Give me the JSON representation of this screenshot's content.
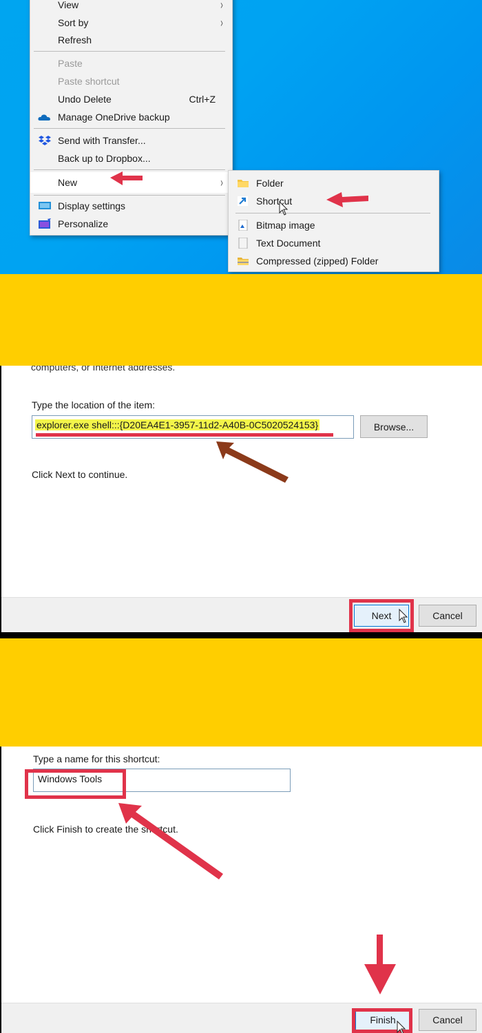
{
  "context_menu": {
    "items": [
      {
        "label": "View",
        "submenu": true
      },
      {
        "label": "Sort by",
        "submenu": true
      },
      {
        "label": "Refresh"
      },
      {
        "label": "Paste",
        "disabled": true
      },
      {
        "label": "Paste shortcut",
        "disabled": true
      },
      {
        "label": "Undo Delete",
        "shortcut": "Ctrl+Z"
      },
      {
        "label": "Manage OneDrive backup",
        "icon": "onedrive-cloud-icon"
      },
      {
        "label": "Send with Transfer...",
        "icon": "dropbox-icon"
      },
      {
        "label": "Back up to Dropbox..."
      },
      {
        "label": "New",
        "submenu": true,
        "highlighted": true
      },
      {
        "label": "Display settings",
        "icon": "display-icon"
      },
      {
        "label": "Personalize",
        "icon": "personalize-icon"
      }
    ],
    "chevron": "›"
  },
  "new_submenu": {
    "items": [
      {
        "label": "Folder",
        "icon": "folder-icon"
      },
      {
        "label": "Shortcut",
        "icon": "shortcut-arrow-icon"
      },
      {
        "label": "Bitmap image",
        "icon": "bitmap-icon"
      },
      {
        "label": "Text Document",
        "icon": "text-document-icon"
      },
      {
        "label": "Compressed (zipped) Folder",
        "icon": "zip-folder-icon"
      }
    ]
  },
  "location_dialog": {
    "intro_fragment": "computers, or Internet addresses.",
    "prompt": "Type the location of the item:",
    "location_value": "explorer.exe shell:::{D20EA4E1-3957-11d2-A40B-0C5020524153}",
    "browse_label": "Browse...",
    "continue_hint": "Click Next to continue.",
    "next_label": "Next",
    "cancel_label": "Cancel"
  },
  "name_dialog": {
    "prompt": "Type a name for this shortcut:",
    "name_value": "Windows Tools",
    "finish_hint": "Click Finish to create the shortcut.",
    "finish_label": "Finish",
    "cancel_label": "Cancel"
  },
  "colors": {
    "desktop_blue": "#00a3f2",
    "banner_yellow": "#ffce00",
    "annotation_red": "#e0334a",
    "annotation_brown": "#8b3a1a",
    "highlight_yellow": "#f3f54a"
  }
}
